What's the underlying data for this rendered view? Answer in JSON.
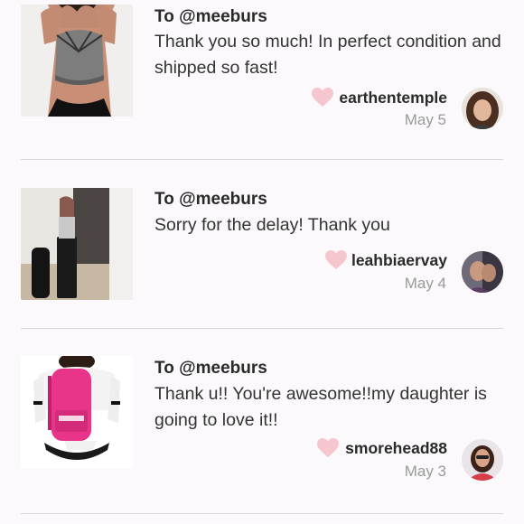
{
  "reviews": [
    {
      "recipient": "To @meeburs",
      "message": "Thank you so much! In perfect condition and shipped so fast!",
      "username": "earthentemple",
      "date": "May 5",
      "thumbnail": "sports-bra-photo",
      "avatar": "user-avatar-photo"
    },
    {
      "recipient": "To @meeburs",
      "message": "Sorry for the delay! Thank you",
      "username": "leahbiaervay",
      "date": "May 4",
      "thumbnail": "lipstick-photo",
      "avatar": "user-avatar-photo"
    },
    {
      "recipient": "To @meeburs",
      "message": "Thank u!! You're awesome!!my daughter is going to love it!!",
      "username": "smorehead88",
      "date": "May 3",
      "thumbnail": "pink-backpack-photo",
      "avatar": "user-avatar-photo"
    }
  ],
  "colors": {
    "background": "#fbf9fb",
    "heart": "#f6c6cf",
    "date": "#9a9a9a",
    "divider": "#d9d6d9"
  }
}
